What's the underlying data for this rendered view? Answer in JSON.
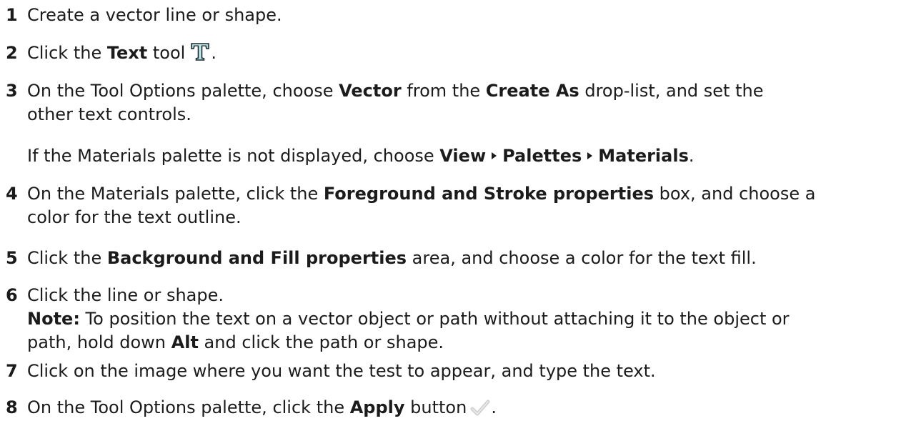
{
  "steps": [
    {
      "num": "1",
      "pre": "Create a vector line or shape."
    },
    {
      "num": "2",
      "pre": "Click the ",
      "b1": "Text",
      "post1": " tool",
      "icon": "text-tool-icon",
      "end": "."
    },
    {
      "num": "3",
      "pre": "On the Tool Options palette, choose ",
      "b1": "Vector",
      "mid": " from the ",
      "b2": "Create As",
      "post": " drop-list, and set the",
      "line2": "other text controls."
    },
    {
      "num": "4",
      "pre": "On the Materials palette, click the ",
      "b1": "Foreground and Stroke properties",
      "post": " box, and choose a",
      "line2": "color for the text outline."
    },
    {
      "num": "5",
      "pre": "Click the ",
      "b1": "Background and Fill properties",
      "post": " area, and choose a color for the text fill."
    },
    {
      "num": "6",
      "pre": "Click the line or shape."
    },
    {
      "num": "7",
      "pre": "Click on the image where you want the test to appear, and type the text."
    },
    {
      "num": "8",
      "pre": "On the Tool Options palette, click the ",
      "b1": "Apply",
      "post": " button",
      "icon": "check-icon",
      "end": "."
    }
  ],
  "materials_note": {
    "pre": "If the Materials palette is not displayed, choose ",
    "m1": "View",
    "m2": "Palettes",
    "m3": "Materials",
    "end": "."
  },
  "note": {
    "label": "Note:",
    "line1": " To position the text on a vector object or path without attaching it to the object or",
    "line2a": "path, hold down ",
    "key": "Alt",
    "line2b": " and click the path or shape."
  }
}
